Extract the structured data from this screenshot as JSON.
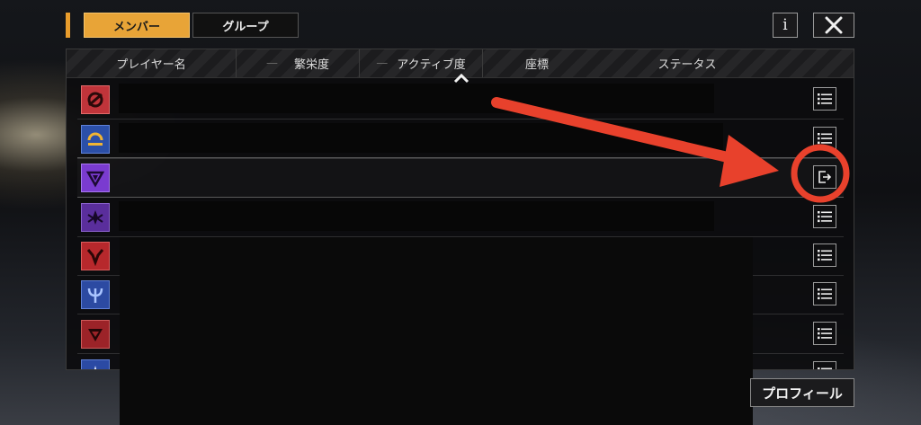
{
  "tabs": {
    "members_label": "メンバー",
    "groups_label": "グループ"
  },
  "toolbar": {
    "info_label": "i"
  },
  "table": {
    "headers": {
      "player_name": "プレイヤー名",
      "prosperity": "繁栄度",
      "activity": "アクティブ度",
      "coordinates": "座標",
      "status": "ステータス"
    },
    "rows": [
      {
        "avatar_icon": "faction-emblem-red-swirl",
        "avatar_color": "#c0343a",
        "action": "list-menu-icon"
      },
      {
        "avatar_icon": "faction-emblem-blue-ring",
        "avatar_color": "#2b4fa8",
        "action": "list-menu-icon"
      },
      {
        "avatar_icon": "faction-emblem-purple-triangle",
        "avatar_color": "#7a3bd0",
        "action": "exit-icon"
      },
      {
        "avatar_icon": "faction-emblem-purple-winged",
        "avatar_color": "#5a2e9c",
        "action": "list-menu-icon"
      },
      {
        "avatar_icon": "faction-emblem-red-horns",
        "avatar_color": "#b7282c",
        "action": "list-menu-icon"
      },
      {
        "avatar_icon": "faction-emblem-blue-trident",
        "avatar_color": "#2c4aa2",
        "action": "list-menu-icon"
      },
      {
        "avatar_icon": "faction-emblem-red-chevron",
        "avatar_color": "#9c2328",
        "action": "list-menu-icon"
      },
      {
        "avatar_icon": "faction-emblem-blue-spire",
        "avatar_color": "#2b4aa4",
        "action": "list-menu-icon"
      }
    ]
  },
  "footer": {
    "profile_label": "プロフィール"
  },
  "annotation": {
    "color": "#e8412c"
  },
  "theme": {
    "accent": "#e8a437"
  }
}
